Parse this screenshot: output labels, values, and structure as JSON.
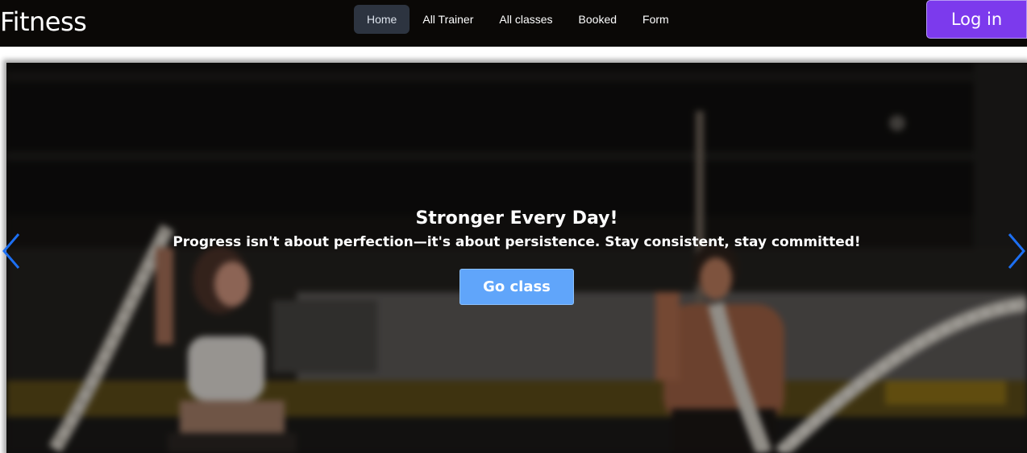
{
  "brand": {
    "name": "Fitness"
  },
  "nav": {
    "items": [
      {
        "label": "Home",
        "active": true
      },
      {
        "label": "All Trainer",
        "active": false
      },
      {
        "label": "All classes",
        "active": false
      },
      {
        "label": "Booked",
        "active": false
      },
      {
        "label": "Form",
        "active": false
      }
    ]
  },
  "auth": {
    "login_label": "Log in"
  },
  "hero": {
    "title": "Stronger Every Day!",
    "subtitle": "Progress isn't about perfection—it's about persistence. Stay consistent, stay committed!",
    "cta_label": "Go class",
    "prev_icon": "chevron-left-icon",
    "next_icon": "chevron-right-icon"
  },
  "colors": {
    "navbar_bg": "#0a0806",
    "active_nav_bg": "#2d3440",
    "login_bg": "#7c3aed",
    "cta_bg": "#60a5fa",
    "arrow_color": "#1d6ff2"
  }
}
